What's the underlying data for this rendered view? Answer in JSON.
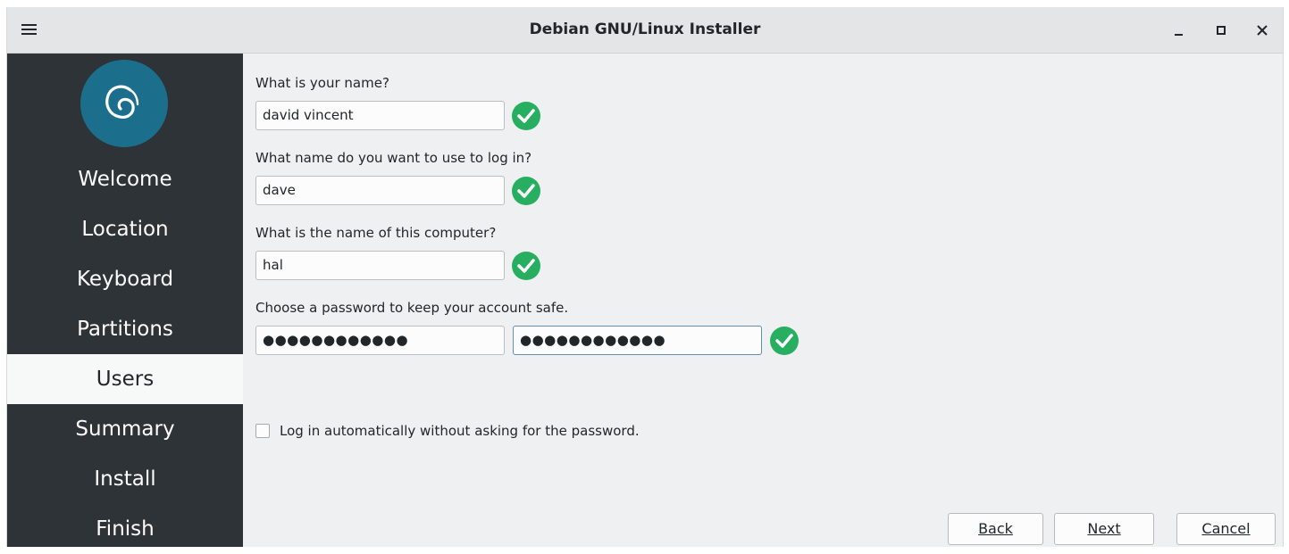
{
  "window": {
    "title": "Debian GNU/Linux Installer",
    "menu_icon": "hamburger-icon",
    "minimize_icon": "minimize-icon",
    "maximize_icon": "maximize-icon",
    "close_icon": "close-icon"
  },
  "sidebar": {
    "logo_icon": "debian-swirl-icon",
    "steps": [
      {
        "label": "Welcome",
        "active": false
      },
      {
        "label": "Location",
        "active": false
      },
      {
        "label": "Keyboard",
        "active": false
      },
      {
        "label": "Partitions",
        "active": false
      },
      {
        "label": "Users",
        "active": true
      },
      {
        "label": "Summary",
        "active": false
      },
      {
        "label": "Install",
        "active": false
      },
      {
        "label": "Finish",
        "active": false
      }
    ]
  },
  "form": {
    "name_label": "What is your name?",
    "name_value": "david vincent",
    "login_label": "What name do you want to use to log in?",
    "login_value": "dave",
    "computer_label": "What is the name of this computer?",
    "computer_value": "hal",
    "password_label": "Choose a password to keep your account safe.",
    "password_value": "●●●●●●●●●●●●",
    "password_confirm_value": "●●●●●●●●●●●●",
    "autologin_label": "Log in automatically without asking for the password.",
    "autologin_checked": false,
    "valid_icon": "green-check-icon",
    "valid_color": "#27ae60"
  },
  "buttons": {
    "back": "Back",
    "next": "Next",
    "cancel": "Cancel"
  },
  "colors": {
    "sidebar_bg": "#2d3336",
    "logo_bg": "#1b6f8d",
    "content_bg": "#eff0f1"
  }
}
